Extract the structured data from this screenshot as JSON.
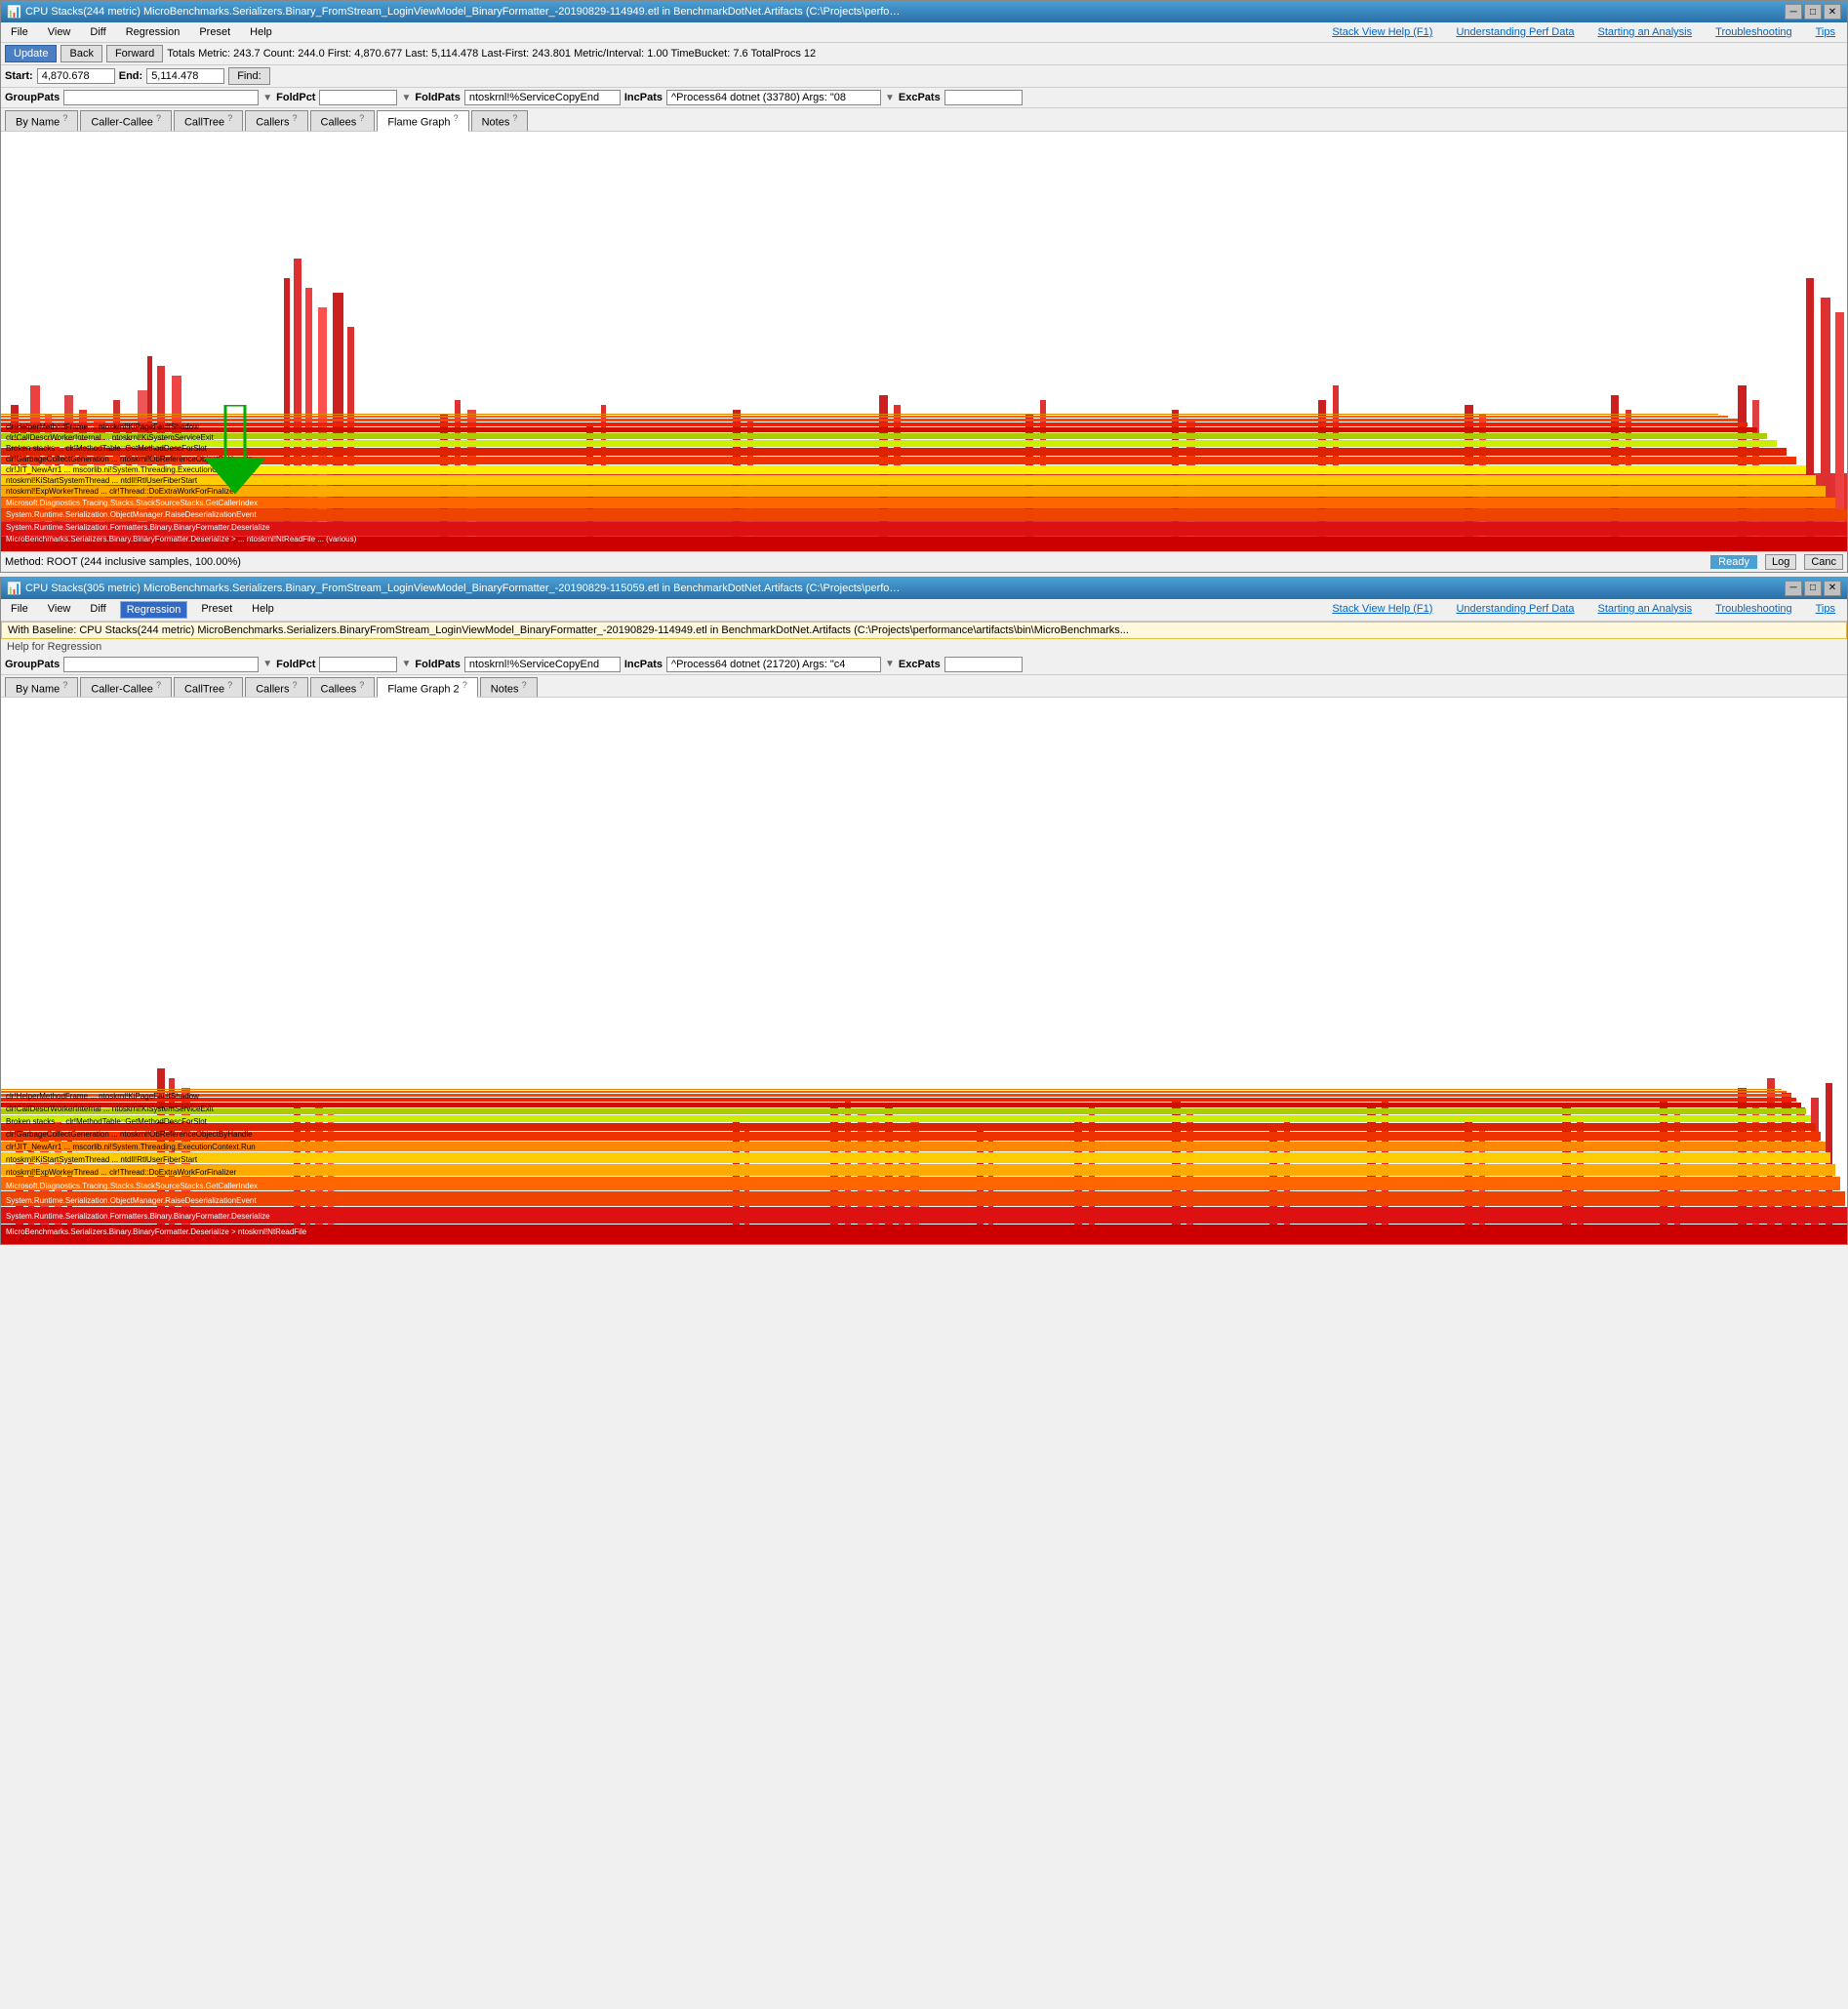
{
  "window1": {
    "title": "CPU Stacks(244 metric) MicroBenchmarks.Serializers.Binary_FromStream_LoginViewModel_BinaryFormatter_-20190829-114949.etl in BenchmarkDotNet.Artifacts (C:\\Projects\\performance\\artifacts\\bin\\MicroBenc...",
    "menu": [
      "File",
      "View",
      "Diff",
      "Regression",
      "Preset",
      "Help"
    ],
    "links": [
      "Stack View Help (F1)",
      "Understanding Perf Data",
      "Starting an Analysis",
      "Troubleshooting",
      "Tips"
    ],
    "toolbar": {
      "update": "Update",
      "back": "Back",
      "forward": "Forward",
      "totals": "Totals Metric: 243.7  Count: 244.0  First: 4,870.677  Last: 5,114.478  Last-First: 243.801  Metric/Interval: 1.00  TimeBucket: 7.6  TotalProcs 12"
    },
    "range_bar": {
      "start_label": "Start:",
      "start_val": "4,870.678",
      "end_label": "End:",
      "end_val": "5,114.478",
      "find_label": "Find:"
    },
    "group_pats": {
      "label": "GroupPats",
      "fold_pct": "FoldPct",
      "fold_pats": "FoldPats",
      "fold_pats_val": "ntoskrnl!%ServiceCopyEnd",
      "inc_pats": "IncPats",
      "inc_pats_val": "^Process64 dotnet (33780) Args: \"08",
      "exc_pats": "ExcPats"
    },
    "tabs": [
      {
        "label": "By Name",
        "q": "?"
      },
      {
        "label": "Caller-Callee",
        "q": "?"
      },
      {
        "label": "CallTree",
        "q": "?"
      },
      {
        "label": "Callers",
        "q": "?"
      },
      {
        "label": "Callees",
        "q": "?"
      },
      {
        "label": "Flame Graph",
        "q": "?",
        "active": true
      },
      {
        "label": "Notes",
        "q": "?"
      }
    ],
    "status": {
      "method": "Method: ROOT (244 inclusive samples, 100.00%)",
      "ready": "Ready",
      "log": "Log",
      "cancel": "Canc"
    }
  },
  "window2": {
    "title": "CPU Stacks(305 metric) MicroBenchmarks.Serializers.Binary_FromStream_LoginViewModel_BinaryFormatter_-20190829-115059.etl in BenchmarkDotNet.Artifacts (C:\\Projects\\performance\\artifacts\\bin\\MicroBenc...",
    "menu": [
      "File",
      "View",
      "Diff",
      "Regression",
      "Preset",
      "Help"
    ],
    "links": [
      "Stack View Help (F1)",
      "Understanding Perf Data",
      "Starting an Analysis",
      "Troubleshooting",
      "Tips"
    ],
    "regression_active": "Regression",
    "info": "With Baseline: CPU Stacks(244 metric) MicroBenchmarks.Serializers.BinaryFromStream_LoginViewModel_BinaryFormatter_-20190829-114949.etl in BenchmarkDotNet.Artifacts (C:\\Projects\\performance\\artifacts\\bin\\MicroBenchmarks...",
    "help": "Help for Regression",
    "group_pats": {
      "label": "GroupPats",
      "fold_pct": "FoldPct",
      "fold_pats": "FoldPats",
      "fold_pats_val": "ntoskrnl!%ServiceCopyEnd",
      "inc_pats": "IncPats",
      "inc_pats_val": "^Process64 dotnet (21720) Args: \"c4",
      "exc_pats": "ExcPats"
    },
    "tabs": [
      {
        "label": "By Name",
        "q": "?"
      },
      {
        "label": "Caller-Callee",
        "q": "?"
      },
      {
        "label": "CallTree",
        "q": "?"
      },
      {
        "label": "Callers",
        "q": "?"
      },
      {
        "label": "Callees",
        "q": "?"
      },
      {
        "label": "Flame Graph 2",
        "q": "?",
        "active": true
      },
      {
        "label": "Notes",
        "q": "?"
      }
    ]
  },
  "icons": {
    "minimize": "─",
    "maximize": "□",
    "close": "✕"
  }
}
